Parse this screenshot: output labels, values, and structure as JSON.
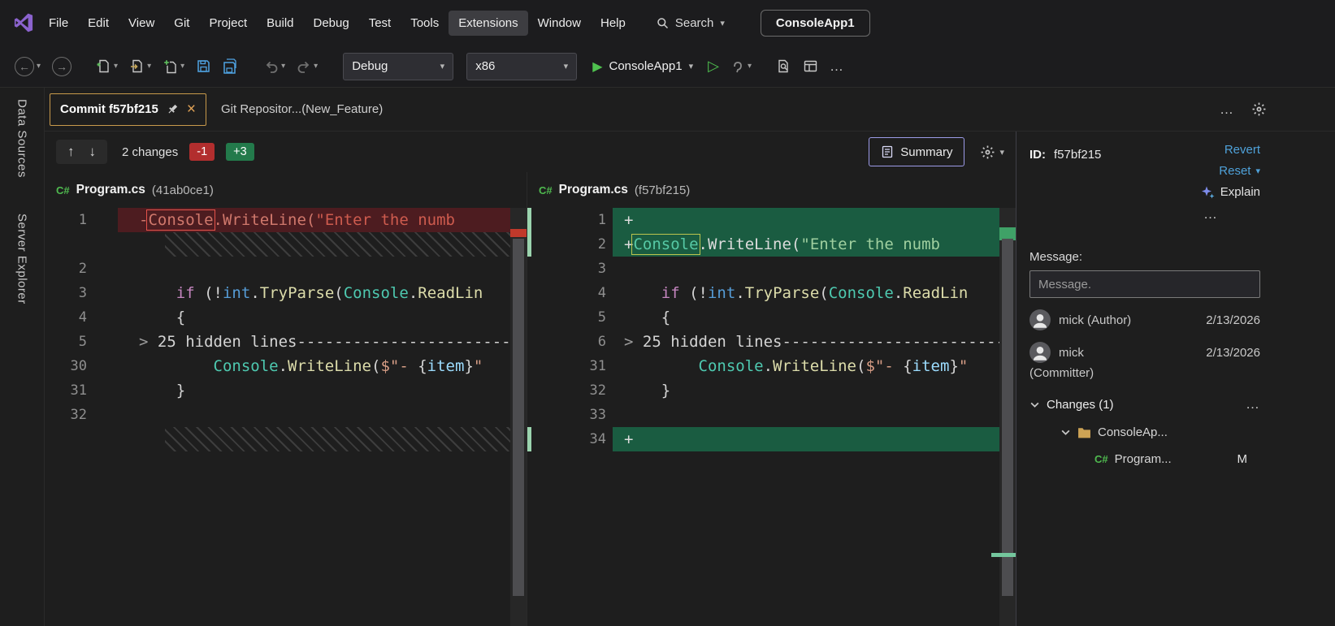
{
  "window": {
    "app_badge": "ConsoleApp1"
  },
  "colors": {
    "tab_accent": "#C89A4B",
    "add_line_bg": "#1A5C41",
    "del_line_bg": "#4D1C20",
    "badge_add": "#237A4B",
    "badge_del": "#B22E2E",
    "link_blue": "#4FA2DA",
    "summary_border": "#9C9BE8",
    "csharp_green": "#4FBA4F",
    "play_green": "#4FC14F"
  },
  "icons": {
    "chevron": "▾",
    "close": "×",
    "play": "▶",
    "play_outline": "▷",
    "up": "↑",
    "down": "↓",
    "back": "←",
    "forward": "→",
    "ellipsis": "…",
    "collapse_chevron": ">"
  },
  "menu": {
    "items": [
      {
        "label": "File"
      },
      {
        "label": "Edit"
      },
      {
        "label": "View"
      },
      {
        "label": "Git"
      },
      {
        "label": "Project"
      },
      {
        "label": "Build"
      },
      {
        "label": "Debug"
      },
      {
        "label": "Test"
      },
      {
        "label": "Tools"
      },
      {
        "label": "Extensions",
        "active": true
      },
      {
        "label": "Window"
      },
      {
        "label": "Help"
      }
    ],
    "search_label": "Search"
  },
  "toolbar": {
    "config": "Debug",
    "platform": "x86",
    "run_target": "ConsoleApp1",
    "overflow": "…"
  },
  "side_rail": {
    "items": [
      "Data Sources",
      "Server Explorer"
    ]
  },
  "tabs": {
    "tab1": "Commit f57bf215",
    "tab2": "Git Repositor...(New_Feature)",
    "overflow": "…"
  },
  "diff_toolbar": {
    "changes": "2 changes",
    "deletions": "-1",
    "additions": "+3",
    "summary": "Summary"
  },
  "diff": {
    "left": {
      "lang": "C#",
      "file": "Program.cs",
      "rev": "(41ab0ce1)",
      "lines": [
        {
          "num": "1",
          "kind": "del",
          "tokens": [
            [
              "-",
              "del"
            ],
            [
              "Console",
              "delbox"
            ],
            [
              ".WriteLine(",
              "del"
            ],
            [
              "\"Enter the numb",
              "delstr"
            ]
          ]
        },
        {
          "kind": "filler"
        },
        {
          "num": "2",
          "kind": "code",
          "tokens": []
        },
        {
          "num": "3",
          "kind": "code",
          "tokens": [
            [
              "    ",
              "p"
            ],
            [
              "if",
              "kw"
            ],
            [
              " (!",
              "p"
            ],
            [
              "int",
              "type"
            ],
            [
              ".",
              "p"
            ],
            [
              "TryParse",
              "m"
            ],
            [
              "(",
              "p"
            ],
            [
              "Console",
              "cls"
            ],
            [
              ".",
              "p"
            ],
            [
              "ReadLin",
              "m"
            ]
          ]
        },
        {
          "num": "4",
          "kind": "code",
          "tokens": [
            [
              "    {",
              "p"
            ]
          ]
        },
        {
          "num": "5",
          "kind": "code",
          "collapsed": true,
          "tokens": [
            [
              "25 hidden lines",
              "p"
            ],
            [
              "-----------------------------------",
              "p"
            ]
          ]
        },
        {
          "num": "30",
          "kind": "code",
          "tokens": [
            [
              "        ",
              "p"
            ],
            [
              "Console",
              "cls"
            ],
            [
              ".",
              "p"
            ],
            [
              "WriteLine",
              "m"
            ],
            [
              "(",
              "p"
            ],
            [
              "$\"- ",
              "str"
            ],
            [
              "{",
              "p"
            ],
            [
              "item",
              "var"
            ],
            [
              "}",
              "p"
            ],
            [
              "\"",
              "str"
            ]
          ]
        },
        {
          "num": "31",
          "kind": "code",
          "tokens": [
            [
              "    }",
              "p"
            ]
          ]
        },
        {
          "num": "32",
          "kind": "code",
          "tokens": []
        },
        {
          "kind": "filler"
        }
      ]
    },
    "right": {
      "lang": "C#",
      "file": "Program.cs",
      "rev": "(f57bf215)",
      "lines": [
        {
          "num": "1",
          "kind": "add",
          "tokens": [
            [
              "+",
              "addp"
            ]
          ]
        },
        {
          "num": "2",
          "kind": "add",
          "tokens": [
            [
              "+",
              "addp"
            ],
            [
              "Console",
              "addbox"
            ],
            [
              ".WriteLine(",
              "addp"
            ],
            [
              "\"Enter the numb",
              "addstr"
            ]
          ]
        },
        {
          "num": "3",
          "kind": "code",
          "tokens": []
        },
        {
          "num": "4",
          "kind": "code",
          "tokens": [
            [
              "    ",
              "p"
            ],
            [
              "if",
              "kw"
            ],
            [
              " (!",
              "p"
            ],
            [
              "int",
              "type"
            ],
            [
              ".",
              "p"
            ],
            [
              "TryParse",
              "m"
            ],
            [
              "(",
              "p"
            ],
            [
              "Console",
              "cls"
            ],
            [
              ".",
              "p"
            ],
            [
              "ReadLin",
              "m"
            ]
          ]
        },
        {
          "num": "5",
          "kind": "code",
          "tokens": [
            [
              "    {",
              "p"
            ]
          ]
        },
        {
          "num": "6",
          "kind": "code",
          "collapsed": true,
          "tokens": [
            [
              "25 hidden lines",
              "p"
            ],
            [
              "-----------------------------------",
              "p"
            ]
          ]
        },
        {
          "num": "31",
          "kind": "code",
          "tokens": [
            [
              "        ",
              "p"
            ],
            [
              "Console",
              "cls"
            ],
            [
              ".",
              "p"
            ],
            [
              "WriteLine",
              "m"
            ],
            [
              "(",
              "p"
            ],
            [
              "$\"- ",
              "str"
            ],
            [
              "{",
              "p"
            ],
            [
              "item",
              "var"
            ],
            [
              "}",
              "p"
            ],
            [
              "\"",
              "str"
            ]
          ]
        },
        {
          "num": "32",
          "kind": "code",
          "tokens": [
            [
              "    }",
              "p"
            ]
          ]
        },
        {
          "num": "33",
          "kind": "code",
          "tokens": []
        },
        {
          "num": "34",
          "kind": "add",
          "tokens": [
            [
              "+",
              "addp"
            ]
          ]
        }
      ]
    }
  },
  "details": {
    "id_label": "ID:",
    "id_value": "f57bf215",
    "revert_label": "Revert",
    "reset_label": "Reset",
    "explain_label": "Explain",
    "message_label": "Message:",
    "message_placeholder": "Message.",
    "people": [
      {
        "name": "mick (Author)",
        "date": "2/13/2026"
      },
      {
        "name": "mick",
        "date": "2/13/2026",
        "role": "(Committer)"
      }
    ],
    "changes_header": "Changes (1)",
    "tree": {
      "folder": "ConsoleAp...",
      "file_lang": "C#",
      "file": "Program...",
      "status": "M"
    }
  }
}
